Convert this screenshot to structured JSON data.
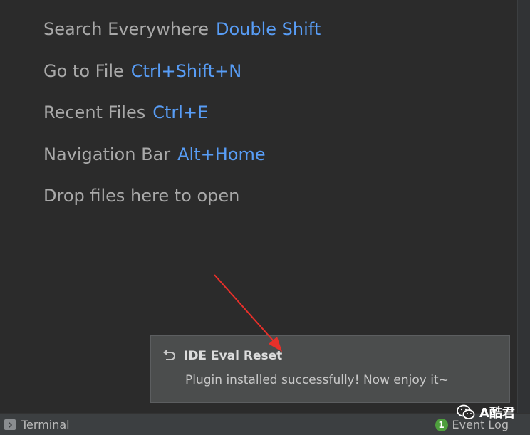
{
  "hints": [
    {
      "label": "Search Everywhere",
      "shortcut": "Double Shift"
    },
    {
      "label": "Go to File",
      "shortcut": "Ctrl+Shift+N"
    },
    {
      "label": "Recent Files",
      "shortcut": "Ctrl+E"
    },
    {
      "label": "Navigation Bar",
      "shortcut": "Alt+Home"
    },
    {
      "label": "Drop files here to open",
      "shortcut": ""
    }
  ],
  "notification": {
    "icon": "reset-icon",
    "title": "IDE Eval Reset",
    "body": "Plugin installed successfully! Now enjoy it~"
  },
  "statusbar": {
    "terminal_label": "Terminal",
    "terminal_icon": "terminal-icon",
    "event_log_label": "Event Log",
    "event_log_count": "1"
  },
  "watermark": {
    "text": "A酷君",
    "icon": "wechat-icon"
  },
  "colors": {
    "background": "#2b2b2b",
    "hint_label": "#a9a9a9",
    "shortcut_accent": "#589df6",
    "notification_bg": "#4b4d4d",
    "annotation_arrow": "#e8302a",
    "event_badge": "#4e9f3d"
  }
}
